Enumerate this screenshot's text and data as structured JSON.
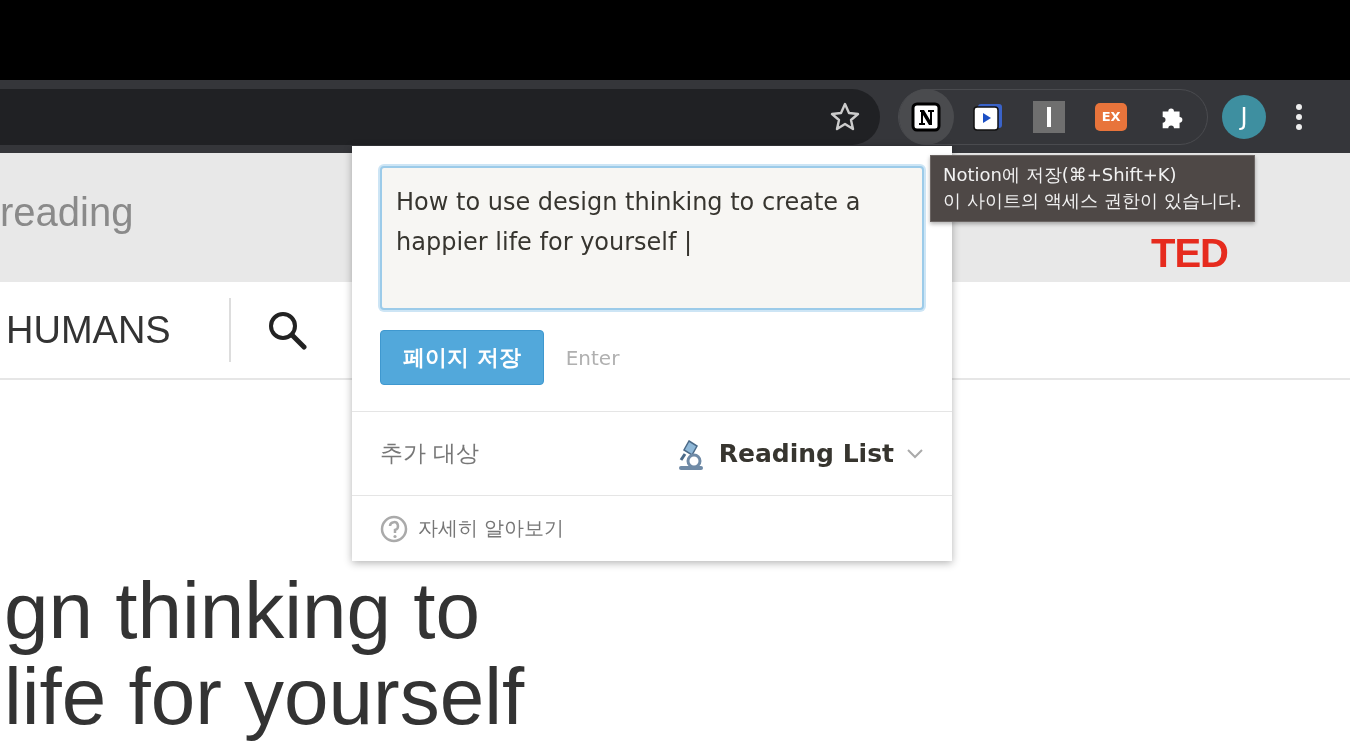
{
  "toolbar": {
    "bookmark": {
      "filled": false
    },
    "extensions": [
      {
        "kind": "notion",
        "highlighted": true
      },
      {
        "kind": "player",
        "highlighted": false
      },
      {
        "kind": "bar",
        "highlighted": false
      },
      {
        "kind": "ex",
        "label": "EX",
        "highlighted": false
      },
      {
        "kind": "puzzle",
        "highlighted": false
      }
    ],
    "avatar": {
      "initial": "J"
    }
  },
  "page": {
    "banner_text": "reading",
    "logo_text": "TED",
    "nav_item": "HUMANS",
    "heading_lines": [
      "gn thinking to",
      "life for yourself"
    ]
  },
  "popup": {
    "title_value": "How to use design thinking to create a happier life for yourself |",
    "save_button": "페이지 저장",
    "shortcut_hint": "Enter",
    "destination_label": "추가 대상",
    "destination": "Reading List",
    "help_link": "자세히 알아보기"
  },
  "tooltip": {
    "lines": [
      "Notion에 저장(⌘+Shift+K)",
      "이 사이트의 액세스 권한이 있습니다."
    ]
  }
}
